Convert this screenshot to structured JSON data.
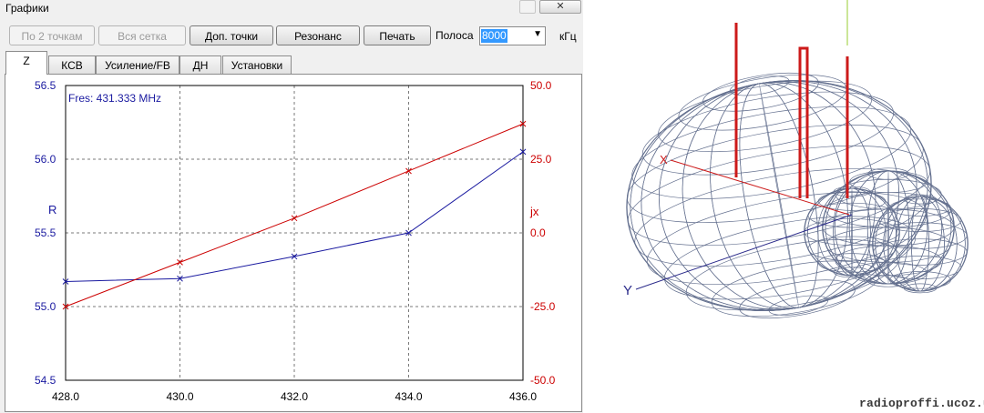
{
  "window": {
    "title": "Графики"
  },
  "toolbar": {
    "btn_two_points": "По 2 точкам",
    "btn_full_grid": "Вся сетка",
    "btn_extra_points": "Доп. точки",
    "btn_resonance": "Резонанс",
    "btn_print": "Печать",
    "band_label": "Полоса",
    "band_value": "8000",
    "band_unit": "кГц"
  },
  "tabs": [
    "Z",
    "КСВ",
    "Усиление/FB",
    "ДН",
    "Установки"
  ],
  "active_tab": "Z",
  "chart_data": {
    "type": "line",
    "annotation": "Fres: 431.333 MHz",
    "x": [
      428.0,
      430.0,
      432.0,
      434.0,
      436.0
    ],
    "x_ticks": [
      "428.0",
      "430.0",
      "432.0",
      "434.0",
      "436.0"
    ],
    "xlim": [
      428,
      436
    ],
    "left_axis": {
      "label": "R",
      "ylim": [
        54.5,
        56.5
      ],
      "ticks": [
        "54.5",
        "55.0",
        "55.5",
        "56.0",
        "56.5"
      ],
      "color": "#1a1aa0"
    },
    "right_axis": {
      "label": "jx",
      "ylim": [
        -50,
        50
      ],
      "ticks": [
        "-50.0",
        "-25.0",
        "0.0",
        "25.0",
        "50.0"
      ],
      "color": "#cc0000"
    },
    "series": [
      {
        "name": "R",
        "axis": "left",
        "color": "#1a1aa0",
        "values": [
          55.17,
          55.19,
          55.34,
          55.5,
          56.05
        ]
      },
      {
        "name": "jx",
        "axis": "right",
        "color": "#cc0000",
        "values": [
          -25,
          -10,
          5,
          21,
          37
        ]
      }
    ],
    "grid": true
  },
  "pattern3d": {
    "axis_x_label": "X",
    "axis_y_label": "Y",
    "mesh_color": "#5d6a8a",
    "antenna_color": "#cc1a1a"
  },
  "watermark": "radioproffi.ucoz.ua"
}
